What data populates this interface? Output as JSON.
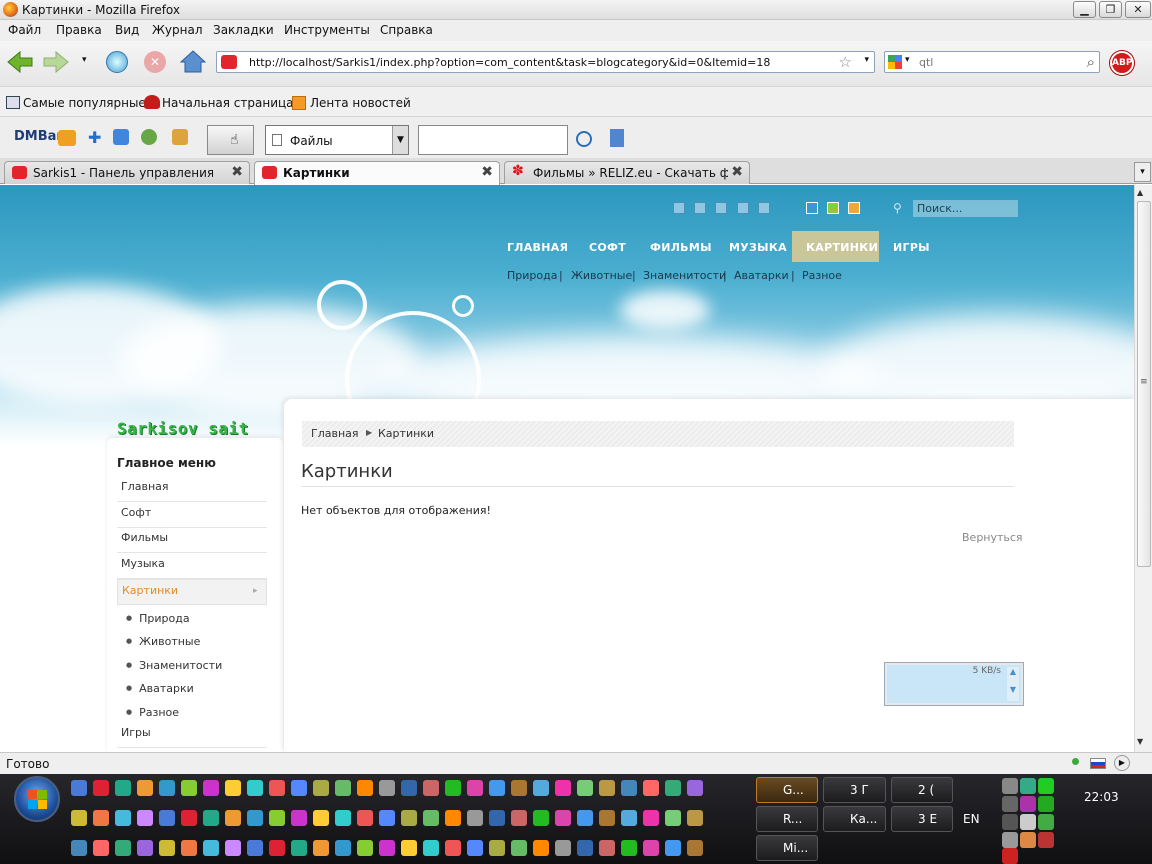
{
  "window": {
    "title": "Картинки - Mozilla Firefox"
  },
  "menubar": [
    "Файл",
    "Правка",
    "Вид",
    "Журнал",
    "Закладки",
    "Инструменты",
    "Справка"
  ],
  "navbar": {
    "url": "http://localhost/Sarkis1/index.php?option=com_content&task=blogcategory&id=0&Itemid=18",
    "search_value": "qtl",
    "abp": "ABP"
  },
  "bookmarks": [
    "Самые популярные",
    "Начальная страница",
    "Лента новостей"
  ],
  "dmbar": {
    "label": "DMBar",
    "folder": "Файлы"
  },
  "tabs": [
    {
      "label": "Sarkis1 - Панель управления!"
    },
    {
      "label": "Картинки"
    },
    {
      "label": "Фильмы » RELIZ.eu - Скачать ф..."
    }
  ],
  "site": {
    "search_placeholder": "Поиск...",
    "topnav": [
      "ГЛАВНАЯ",
      "СОФТ",
      "ФИЛЬМЫ",
      "МУЗЫКА",
      "КАРТИНКИ",
      "ИГРЫ"
    ],
    "subnav": [
      "Природа",
      "Животные",
      "Знаменитости",
      "Аватарки",
      "Разное"
    ],
    "separator": "|",
    "logo": "Sarkisov sait",
    "menu_title": "Главное меню",
    "menu": [
      "Главная",
      "Софт",
      "Фильмы",
      "Музыка",
      "Картинки"
    ],
    "submenu": [
      "Природа",
      "Животные",
      "Знаменитости",
      "Аватарки",
      "Разное"
    ],
    "menu_last": "Игры",
    "breadcrumb": {
      "home": "Главная",
      "current": "Картинки"
    },
    "page_title": "Картинки",
    "empty_text": "Нет объектов для отображения!",
    "back_link": "Вернуться",
    "speed_widget": "5 KB/s"
  },
  "status": {
    "text": "Готово"
  },
  "taskbar": {
    "clock": "22:03",
    "lang": "EN",
    "buttons": [
      "G...",
      "3 Г",
      "2 (",
      "R...",
      "Ка...",
      "3 Е",
      "Mi..."
    ]
  },
  "colors": {
    "accent_active": "#c9c79a",
    "active_menu_text": "#e08c2a",
    "logo_green": "#3bb54a"
  }
}
